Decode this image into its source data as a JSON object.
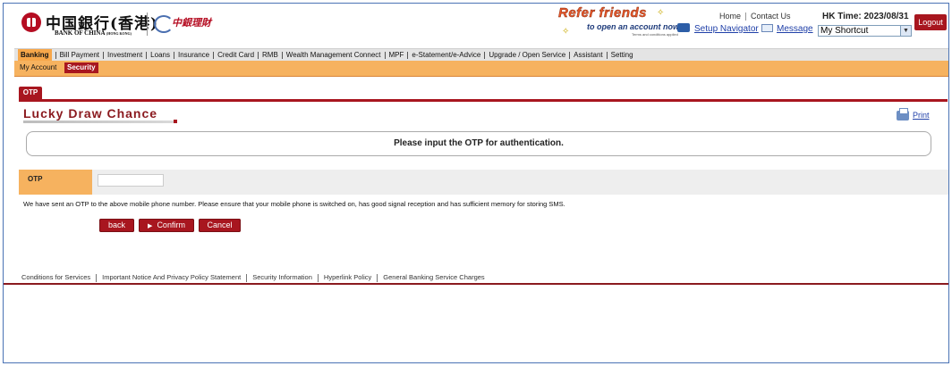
{
  "header": {
    "bank_name_cn": "中国銀行(香港)",
    "bank_name_en": "BANK OF CHINA",
    "bank_name_en_small": "(HONG KONG)",
    "wealth_logo_text": "中銀理財",
    "promo_title": "Refer friends",
    "promo_subtitle": "to open an account now!",
    "promo_terms": "Terms and conditions applied",
    "setup_navigator": "Setup Navigator",
    "message": "Message",
    "home": "Home",
    "contact_us": "Contact Us",
    "hk_time": "HK Time: 2023/08/31",
    "shortcut_value": "My Shortcut",
    "logout": "Logout"
  },
  "nav": {
    "items": [
      "Banking",
      "Bill Payment",
      "Investment",
      "Loans",
      "Insurance",
      "Credit Card",
      "RMB",
      "Wealth Management Connect",
      "MPF",
      "e-Statement/e-Advice",
      "Upgrade / Open Service",
      "Assistant",
      "Setting"
    ],
    "active": "Banking"
  },
  "subnav": {
    "my_account": "My Account",
    "security": "Security"
  },
  "content": {
    "tab_label": "OTP",
    "page_title": "Lucky Draw Chance",
    "print": "Print",
    "instruction": "Please input the OTP for authentication.",
    "otp_field_label": "OTP",
    "otp_value": "",
    "notice": "We have sent an OTP to the above mobile phone number. Please ensure that your mobile phone is switched on, has good signal reception and has sufficient memory for storing SMS.",
    "back_button": "back",
    "confirm_button": "Confirm",
    "cancel_button": "Cancel"
  },
  "footer": {
    "links": [
      "Conditions for Services",
      "Important Notice And Privacy Policy Statement",
      "Security Information",
      "Hyperlink Policy",
      "General Banking Service Charges"
    ]
  },
  "colors": {
    "brand_red": "#a8161f",
    "accent_orange": "#f6b25f",
    "link_blue": "#1f3fa8"
  }
}
